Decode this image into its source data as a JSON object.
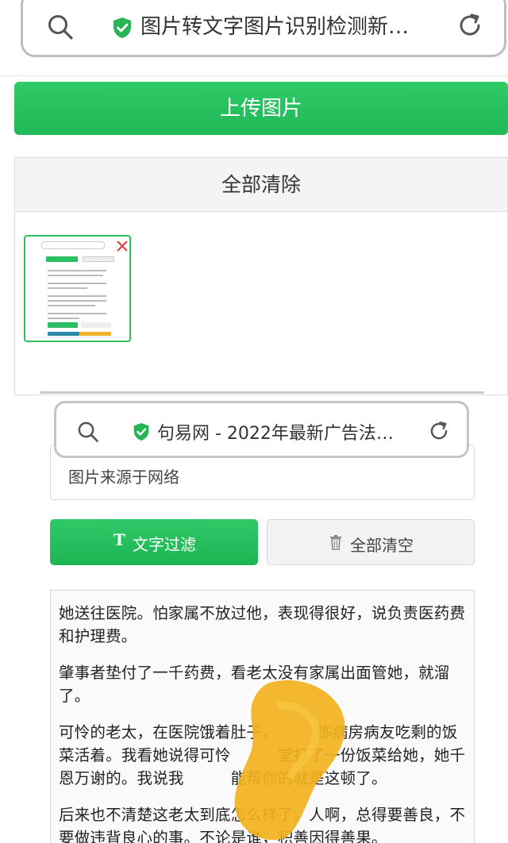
{
  "browser": {
    "title": "图片转文字图片识别检测新…",
    "search_icon": "search-icon",
    "secure_icon": "shield-check-icon",
    "reload_icon": "reload-icon"
  },
  "upload": {
    "label": "上传图片"
  },
  "panel": {
    "clear_all_label": "全部清除",
    "thumbnail_close_icon": "close-icon"
  },
  "inner_browser": {
    "title": "句易网 - 2022年最新广告法…"
  },
  "inner": {
    "partial_text": "图片来源于网络",
    "filter_button_icon": "T",
    "filter_button_label": "文字过滤",
    "clear_button_icon": "trash-icon",
    "clear_button_label": "全部清空",
    "paragraphs": [
      "她送往医院。怕家属不放过他，表现得很好，说负责医药费和护理费。",
      "肇事者垫付了一千药费，看老太没有家属出面管她，就溜了。",
      "可怜的老太，在医院饿着肚子，　　　拣病房病友吃剩的饭菜活着。我看她说得可怜　　　堂打了一份饭菜给她，她千恩万谢的。我说我　　　能帮你的就是这顿了。",
      "后来也不清楚这老太到底怎么样了。人啊，总得要善良，不要做违背良心的事。不论是谁，积善因得善果。"
    ]
  },
  "colors": {
    "green": "#22bb5a",
    "thumb_border": "#2cbf63",
    "close_red": "#e23b3b",
    "smudge": "#f2b21d"
  }
}
